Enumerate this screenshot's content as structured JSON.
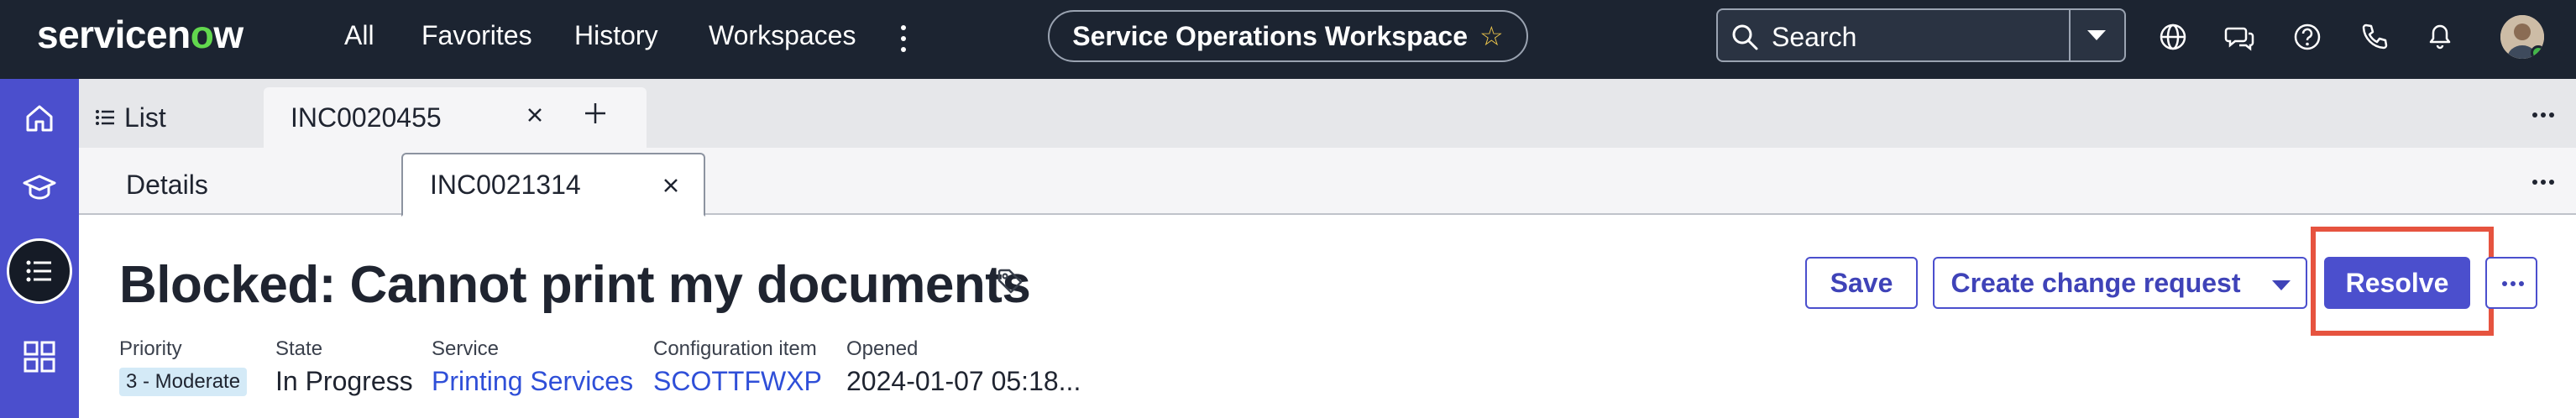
{
  "topnav": {
    "logo": {
      "prefix": "servicen",
      "o": "o",
      "suffix": "w"
    },
    "items": [
      "All",
      "Favorites",
      "History",
      "Workspaces"
    ],
    "workspace_label": "Service Operations Workspace",
    "search_placeholder": "Search"
  },
  "rail": {
    "items": [
      "home",
      "learning",
      "list",
      "apps"
    ],
    "active": "list"
  },
  "tabs_primary": [
    {
      "label": "List"
    },
    {
      "label": "INC0020455"
    }
  ],
  "tabs_secondary": [
    {
      "label": "Details"
    },
    {
      "label": "INC0021314"
    }
  ],
  "record": {
    "title": "Blocked: Cannot print my documents",
    "actions": {
      "save": "Save",
      "create_change": "Create change request",
      "resolve": "Resolve"
    },
    "fields": {
      "priority_label": "Priority",
      "priority_value": "3 - Moderate",
      "state_label": "State",
      "state_value": "In Progress",
      "service_label": "Service",
      "service_value": "Printing Services",
      "ci_label": "Configuration item",
      "ci_value": "SCOTTFWXP",
      "opened_label": "Opened",
      "opened_value": "2024-01-07 05:18..."
    }
  },
  "colors": {
    "topbar": "#1c2431",
    "rail": "#4b4fcd",
    "accent": "#4b4fcd",
    "link": "#2f4fd8",
    "highlight": "#e6533f",
    "logo_o": "#62d84e"
  }
}
